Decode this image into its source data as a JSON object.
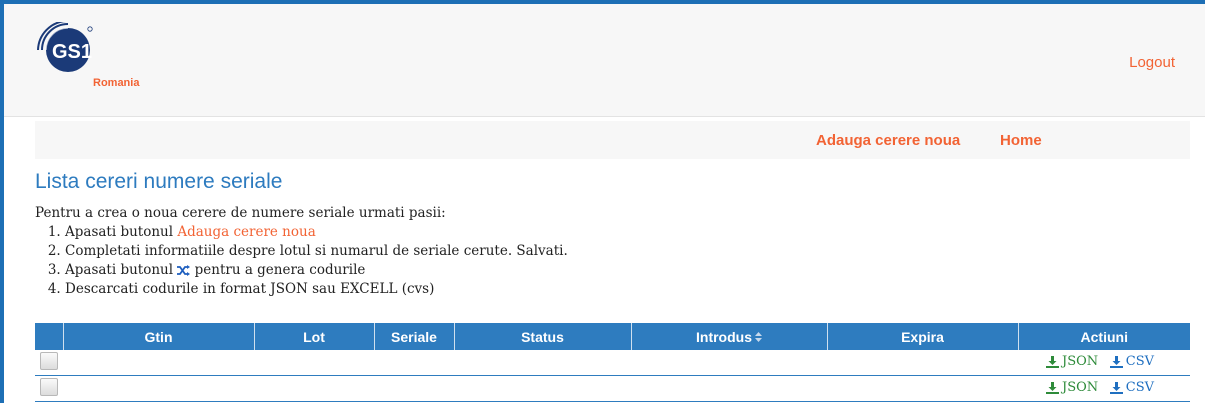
{
  "header": {
    "logo": {
      "text": "GS1",
      "subtext": "Romania"
    },
    "logout_label": "Logout"
  },
  "subnav": {
    "add_label": "Adauga cerere noua",
    "home_label": "Home"
  },
  "page": {
    "title": "Lista cereri numere seriale",
    "intro": "Pentru a crea o noua cerere de numere seriale urmati pasii:",
    "steps": {
      "s1_prefix": "Apasati butonul ",
      "s1_link": "Adauga cerere noua",
      "s2": "Completati informatiile despre lotul si numarul de seriale cerute. Salvati.",
      "s3_prefix": "Apasati butonul ",
      "s3_suffix": " pentru a genera codurile",
      "s4": "Descarcati codurile in format JSON sau EXCELL (cvs)"
    }
  },
  "table": {
    "columns": [
      "",
      "Gtin",
      "Lot",
      "Seriale",
      "Status",
      "Introdus",
      "Expira",
      "Actiuni"
    ],
    "actions": {
      "json_label": "JSON",
      "csv_label": "CSV"
    }
  },
  "colors": {
    "brand_blue": "#2e7cbf",
    "accent_orange": "#f26334",
    "json_green": "#2e8b3a",
    "csv_blue": "#1f6fc0"
  }
}
